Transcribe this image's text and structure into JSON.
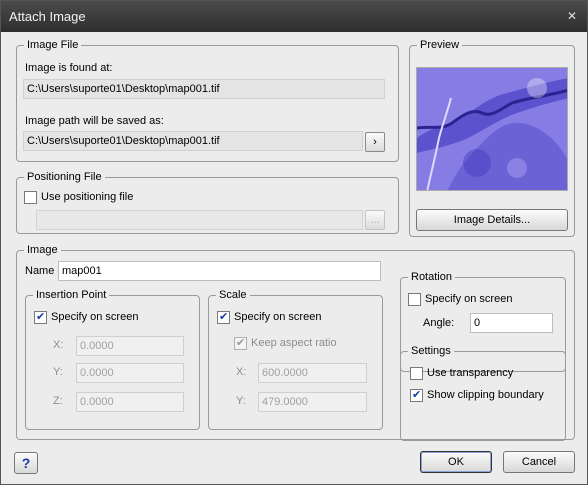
{
  "window": {
    "title": "Attach Image",
    "close_glyph": "✕"
  },
  "image_file": {
    "legend": "Image File",
    "found_label": "Image is found at:",
    "found_path": "C:\\Users\\suporte01\\Desktop\\map001.tif",
    "saved_label": "Image path will be saved as:",
    "saved_path": "C:\\Users\\suporte01\\Desktop\\map001.tif",
    "browse_glyph": "›"
  },
  "positioning_file": {
    "legend": "Positioning File",
    "use_label": "Use positioning file",
    "use_checked": false,
    "path": "",
    "browse_glyph": "..."
  },
  "preview": {
    "legend": "Preview",
    "details_button": "Image Details..."
  },
  "image": {
    "legend": "Image",
    "name_label": "Name",
    "name_value": "map001"
  },
  "insertion_point": {
    "legend": "Insertion Point",
    "specify_label": "Specify on screen",
    "specify_checked": true,
    "x_label": "X:",
    "x_value": "0.0000",
    "y_label": "Y:",
    "y_value": "0.0000",
    "z_label": "Z:",
    "z_value": "0.0000"
  },
  "scale": {
    "legend": "Scale",
    "specify_label": "Specify on screen",
    "specify_checked": true,
    "keep_aspect_label": "Keep aspect ratio",
    "keep_aspect_checked": true,
    "x_label": "X:",
    "x_value": "600.0000",
    "y_label": "Y:",
    "y_value": "479.0000"
  },
  "rotation": {
    "legend": "Rotation",
    "specify_label": "Specify on screen",
    "specify_checked": false,
    "angle_label": "Angle:",
    "angle_value": "0"
  },
  "settings": {
    "legend": "Settings",
    "transparency_label": "Use transparency",
    "transparency_checked": false,
    "clipping_label": "Show clipping boundary",
    "clipping_checked": true
  },
  "footer": {
    "help_label": "?",
    "ok_label": "OK",
    "cancel_label": "Cancel"
  },
  "colors": {
    "preview_tint": "#6b63d6",
    "preview_dark": "#2a2a9a"
  }
}
